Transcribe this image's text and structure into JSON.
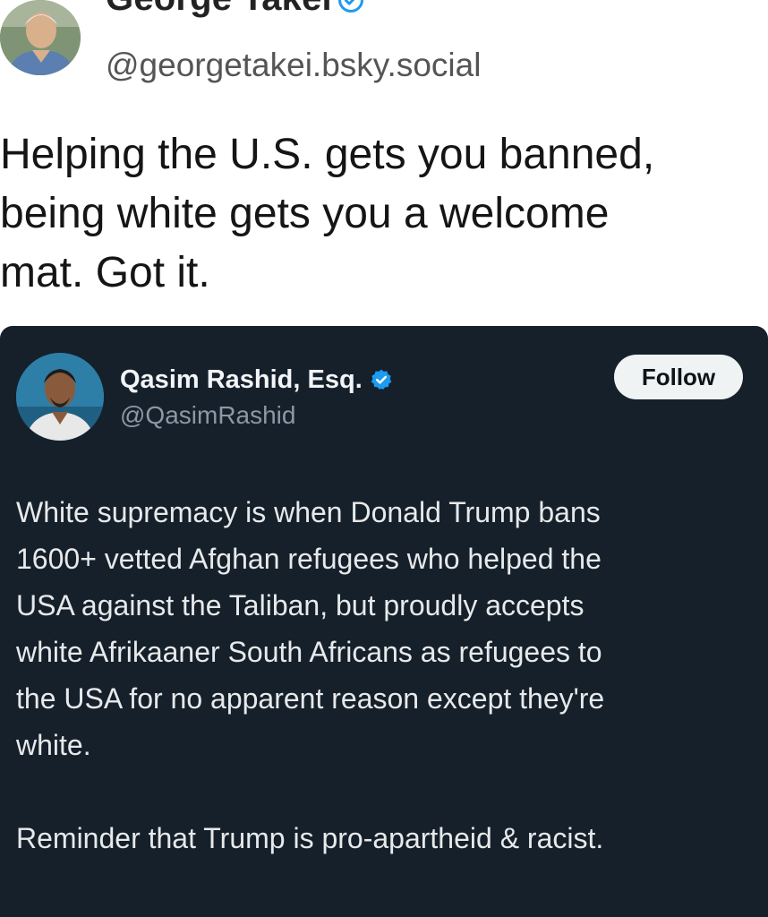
{
  "post": {
    "author_name": "George Takei",
    "author_handle": "@georgetakei.bsky.social",
    "text_lines": [
      "Helping the U.S. gets you banned,",
      "being white gets you a welcome",
      "mat. Got it."
    ],
    "avatar_icon": "person-avatar-icon",
    "verified_icon": "verified-badge-icon",
    "verified_color": "#1d9bf0"
  },
  "quoted": {
    "author_name": "Qasim Rashid, Esq.",
    "author_handle": "@QasimRashid",
    "follow_label": "Follow",
    "avatar_icon": "person-avatar-icon",
    "verified_icon": "verified-badge-icon",
    "verified_color": "#1d9bf0",
    "card_background": "#15202b",
    "paragraph1_lines": [
      "White supremacy is when Donald Trump bans",
      "1600+ vetted Afghan refugees who helped the",
      "USA against the Taliban, but proudly accepts",
      "white Afrikaaner South Africans as refugees to",
      "the USA for no apparent reason except they're",
      "white."
    ],
    "paragraph2_lines": [
      "Reminder that Trump is pro-apartheid & racist."
    ]
  }
}
